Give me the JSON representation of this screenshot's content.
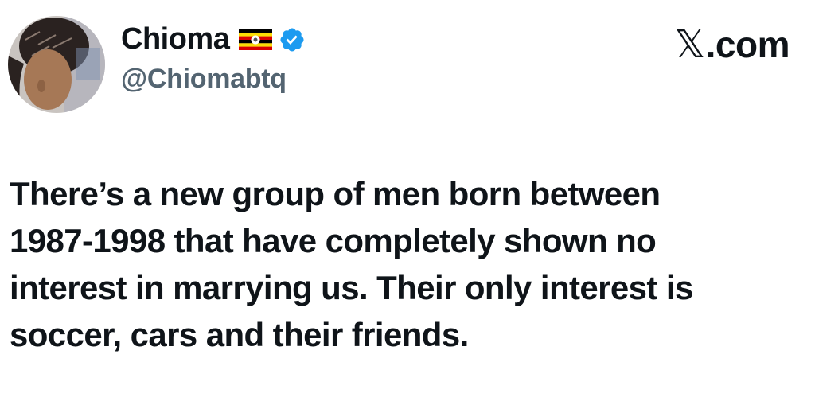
{
  "author": {
    "display_name": "Chioma",
    "handle": "@Chiomabtq",
    "flag_icon": "uganda-flag-icon",
    "verified_icon": "verified-badge-icon",
    "verified_color": "#1d9bf0"
  },
  "watermark": {
    "x_glyph": "𝕏",
    "suffix": ".com"
  },
  "tweet": {
    "lines": [
      "There’s a new group of men born between",
      "1987-1998 that have completely shown no",
      "interest in marrying us. Their only interest is",
      "soccer, cars and their friends."
    ]
  },
  "colors": {
    "text": "#0f1419",
    "handle": "#536471",
    "background": "#ffffff"
  }
}
